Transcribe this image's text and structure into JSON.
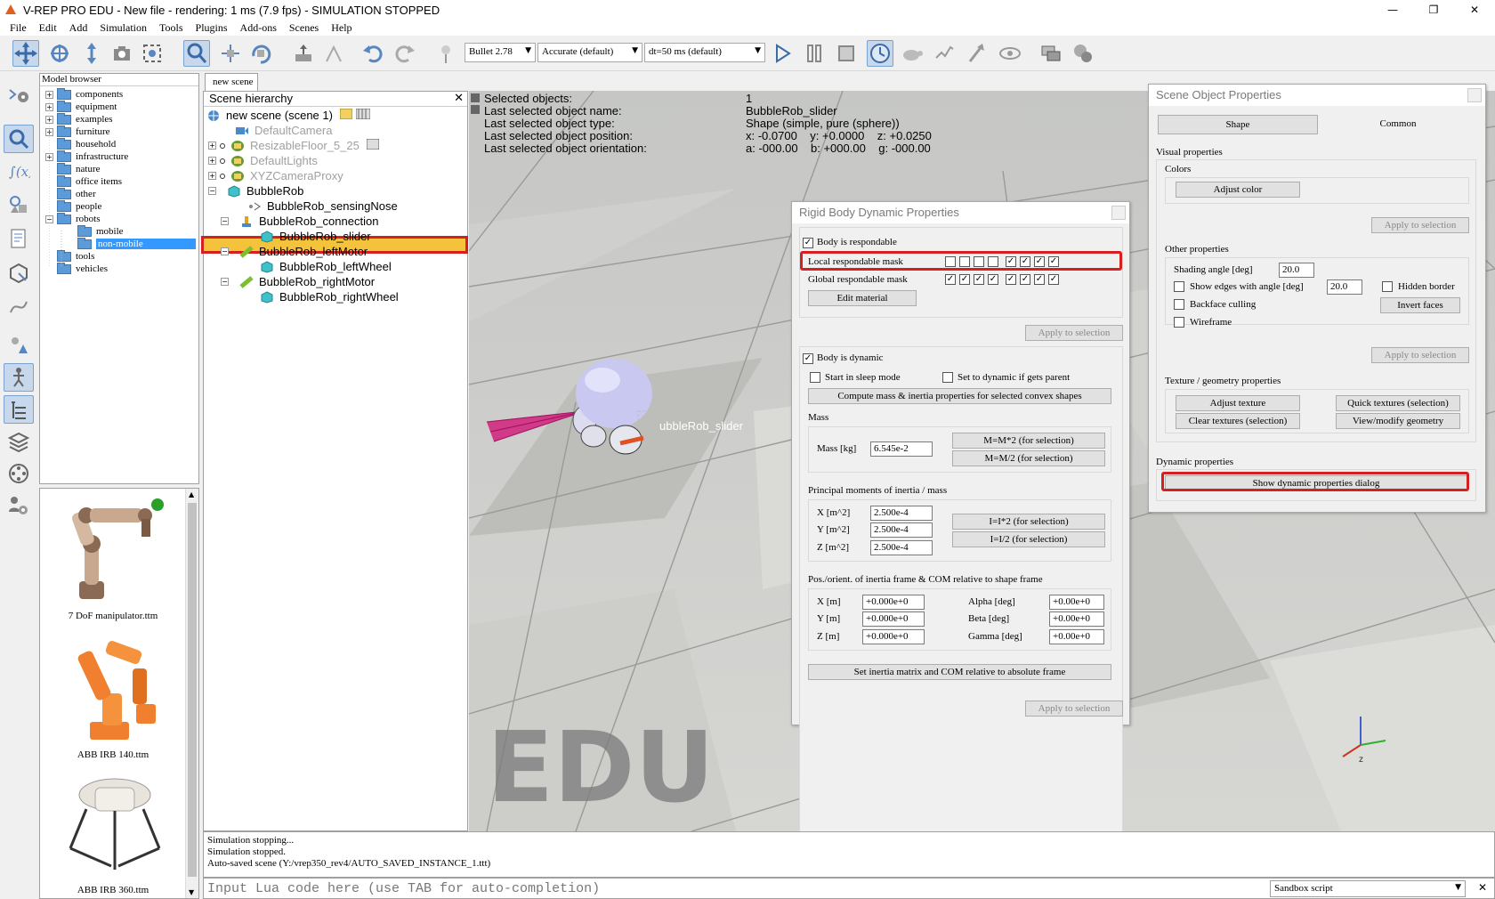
{
  "window": {
    "title": "V-REP PRO EDU - New file - rendering: 1 ms (7.9 fps) - SIMULATION STOPPED",
    "minimize": "—",
    "maximize": "❐",
    "close": "✕"
  },
  "menu": [
    "File",
    "Edit",
    "Add",
    "Simulation",
    "Tools",
    "Plugins",
    "Add-ons",
    "Scenes",
    "Help"
  ],
  "toolbar": {
    "engine": "Bullet 2.78",
    "accuracy": "Accurate (default)",
    "timestep": "dt=50 ms (default)"
  },
  "model_browser": {
    "title": "Model browser",
    "items": [
      "components",
      "equipment",
      "examples",
      "furniture",
      "household",
      "infrastructure",
      "nature",
      "office items",
      "other",
      "people",
      "robots",
      "mobile",
      "non-mobile",
      "tools",
      "vehicles"
    ]
  },
  "thumbnails": [
    {
      "label": "7 DoF manipulator.ttm"
    },
    {
      "label": "ABB IRB 140.ttm"
    },
    {
      "label": "ABB IRB 360.ttm"
    }
  ],
  "scene_tab": "new scene",
  "scene_hierarchy": {
    "title": "Scene hierarchy",
    "close": "✕",
    "items": [
      "new scene (scene 1)",
      "DefaultCamera",
      "ResizableFloor_5_25",
      "DefaultLights",
      "XYZCameraProxy",
      "BubbleRob",
      "BubbleRob_sensingNose",
      "BubbleRob_connection",
      "BubbleRob_slider",
      "BubbleRob_leftMotor",
      "BubbleRob_leftWheel",
      "BubbleRob_rightMotor",
      "BubbleRob_rightWheel"
    ]
  },
  "info": {
    "labels": [
      "Selected objects:",
      "Last selected object name:",
      "Last selected object type:",
      "Last selected object position:",
      "Last selected object orientation:"
    ],
    "values": [
      "1",
      "BubbleRob_slider",
      "Shape (simple, pure (sphere))",
      "x: -0.0700    y: +0.0000    z: +0.0250",
      "a: -000.00    b: +000.00    g: -000.00"
    ]
  },
  "viewport": {
    "object_label": "ubbleRob_slider",
    "watermark": "EDU",
    "axis_z": "z"
  },
  "rigid_body": {
    "title": "Rigid Body Dynamic Properties",
    "body_respondable": "Body is respondable",
    "local_mask": "Local respondable mask",
    "global_mask": "Global respondable mask",
    "local_mask_bits": [
      false,
      false,
      false,
      false,
      true,
      true,
      true,
      true
    ],
    "global_mask_bits": [
      true,
      true,
      true,
      true,
      true,
      true,
      true,
      true
    ],
    "edit_material": "Edit material",
    "apply": "Apply to selection",
    "body_dynamic": "Body is dynamic",
    "start_sleep": "Start in sleep mode",
    "set_dynamic": "Set to dynamic if gets parent",
    "compute_mass": "Compute mass & inertia properties for selected convex shapes",
    "mass_group": "Mass",
    "mass_label": "Mass [kg]",
    "mass_value": "6.545e-2",
    "mass_x2": "M=M*2  (for selection)",
    "mass_div2": "M=M/2  (for selection)",
    "inertia_group": "Principal moments of inertia / mass",
    "ix": "X [m^2]",
    "iy": "Y [m^2]",
    "iz": "Z [m^2]",
    "ix_val": "2.500e-4",
    "iy_val": "2.500e-4",
    "iz_val": "2.500e-4",
    "i_x2": "I=I*2  (for selection)",
    "i_div2": "I=I/2  (for selection)",
    "pos_group": "Pos./orient. of inertia frame & COM relative to shape frame",
    "px": "X [m]",
    "py": "Y [m]",
    "pz": "Z [m]",
    "px_val": "+0.000e+0",
    "py_val": "+0.000e+0",
    "pz_val": "+0.000e+0",
    "alpha": "Alpha [deg]",
    "beta": "Beta [deg]",
    "gamma": "Gamma [deg]",
    "alpha_val": "+0.00e+0",
    "beta_val": "+0.00e+0",
    "gamma_val": "+0.00e+0",
    "set_inertia": "Set inertia matrix and COM relative to absolute frame"
  },
  "scene_obj": {
    "title": "Scene Object Properties",
    "tab_shape": "Shape",
    "tab_common": "Common",
    "visual": "Visual properties",
    "colors": "Colors",
    "adjust_color": "Adjust color",
    "apply": "Apply to selection",
    "other": "Other properties",
    "shading": "Shading angle [deg]",
    "shading_val": "20.0",
    "show_edges": "Show edges with angle [deg]",
    "edges_val": "20.0",
    "hidden_border": "Hidden border",
    "backface": "Backface culling",
    "invert": "Invert faces",
    "wireframe": "Wireframe",
    "texture": "Texture / geometry properties",
    "adjust_texture": "Adjust texture",
    "quick_textures": "Quick textures (selection)",
    "clear_textures": "Clear textures (selection)",
    "view_geometry": "View/modify geometry",
    "dynamic": "Dynamic properties",
    "show_dynamic": "Show dynamic properties dialog"
  },
  "console": [
    "Simulation stopping...",
    "Simulation stopped.",
    "Auto-saved scene (Y:/vrep350_rev4/AUTO_SAVED_INSTANCE_1.ttt)"
  ],
  "lua": {
    "placeholder": "Input Lua code here (use TAB for auto-completion)",
    "script": "Sandbox script",
    "close": "✕"
  },
  "colors": {
    "highlight_red": "#d42020",
    "selection_fill": "#f5c33b",
    "accent_blue": "#3399ff"
  }
}
